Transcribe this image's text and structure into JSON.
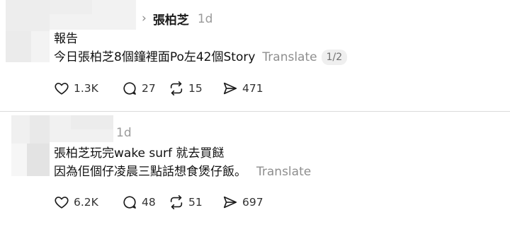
{
  "posts": [
    {
      "reply_to": "張柏芝",
      "time": "1d",
      "lines": [
        "報告",
        "今日張柏芝8個鐘裡面Po左42個Story"
      ],
      "translate_label": "Translate",
      "page_indicator": "1/2",
      "stats": {
        "likes": "1.3K",
        "comments": "27",
        "reposts": "15",
        "shares": "471"
      }
    },
    {
      "time": "1d",
      "lines": [
        "張柏芝玩完wake surf 就去買餸",
        "因為佢個仔凌晨三點話想食煲仔飯。"
      ],
      "translate_label": "Translate",
      "stats": {
        "likes": "6.2K",
        "comments": "48",
        "reposts": "51",
        "shares": "697"
      }
    }
  ],
  "icons": {
    "like": "heart-icon",
    "comment": "comment-bubble-icon",
    "repost": "repost-arrows-icon",
    "share": "send-arrow-icon",
    "chevron": "chevron-right-icon"
  },
  "colors": {
    "text": "#111111",
    "muted": "#8e8e8e",
    "divider": "#dbdbdb",
    "pill_bg": "#efefef"
  }
}
